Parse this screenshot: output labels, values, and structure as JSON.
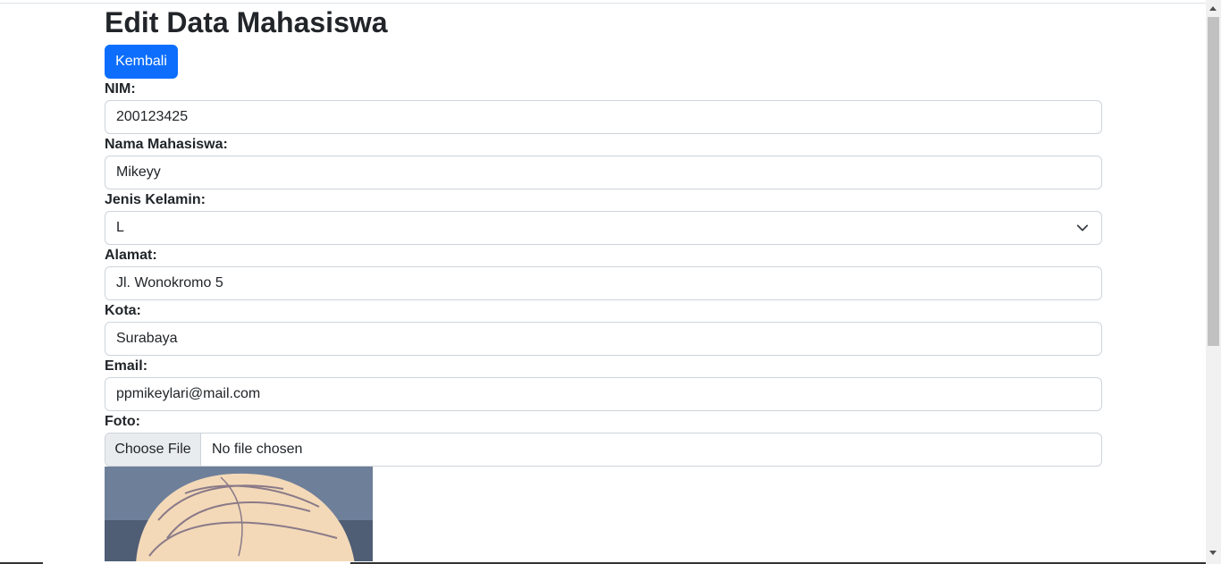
{
  "page": {
    "title": "Edit Data Mahasiswa",
    "back_button": "Kembali"
  },
  "form": {
    "nim": {
      "label": "NIM:",
      "value": "200123425"
    },
    "nama": {
      "label": "Nama Mahasiswa:",
      "value": "Mikeyy"
    },
    "jenis_kelamin": {
      "label": "Jenis Kelamin:",
      "value": "L"
    },
    "alamat": {
      "label": "Alamat:",
      "value": "Jl. Wonokromo 5"
    },
    "kota": {
      "label": "Kota:",
      "value": "Surabaya"
    },
    "email": {
      "label": "Email:",
      "value": "ppmikeylari@mail.com"
    },
    "foto": {
      "label": "Foto:",
      "button": "Choose File",
      "status": "No file chosen"
    }
  },
  "colors": {
    "primary": "#0d6efd",
    "text": "#212529",
    "border": "#ced4da"
  },
  "icons": {
    "select_chevron": "chevron-down-icon",
    "photo": "profile-photo"
  }
}
